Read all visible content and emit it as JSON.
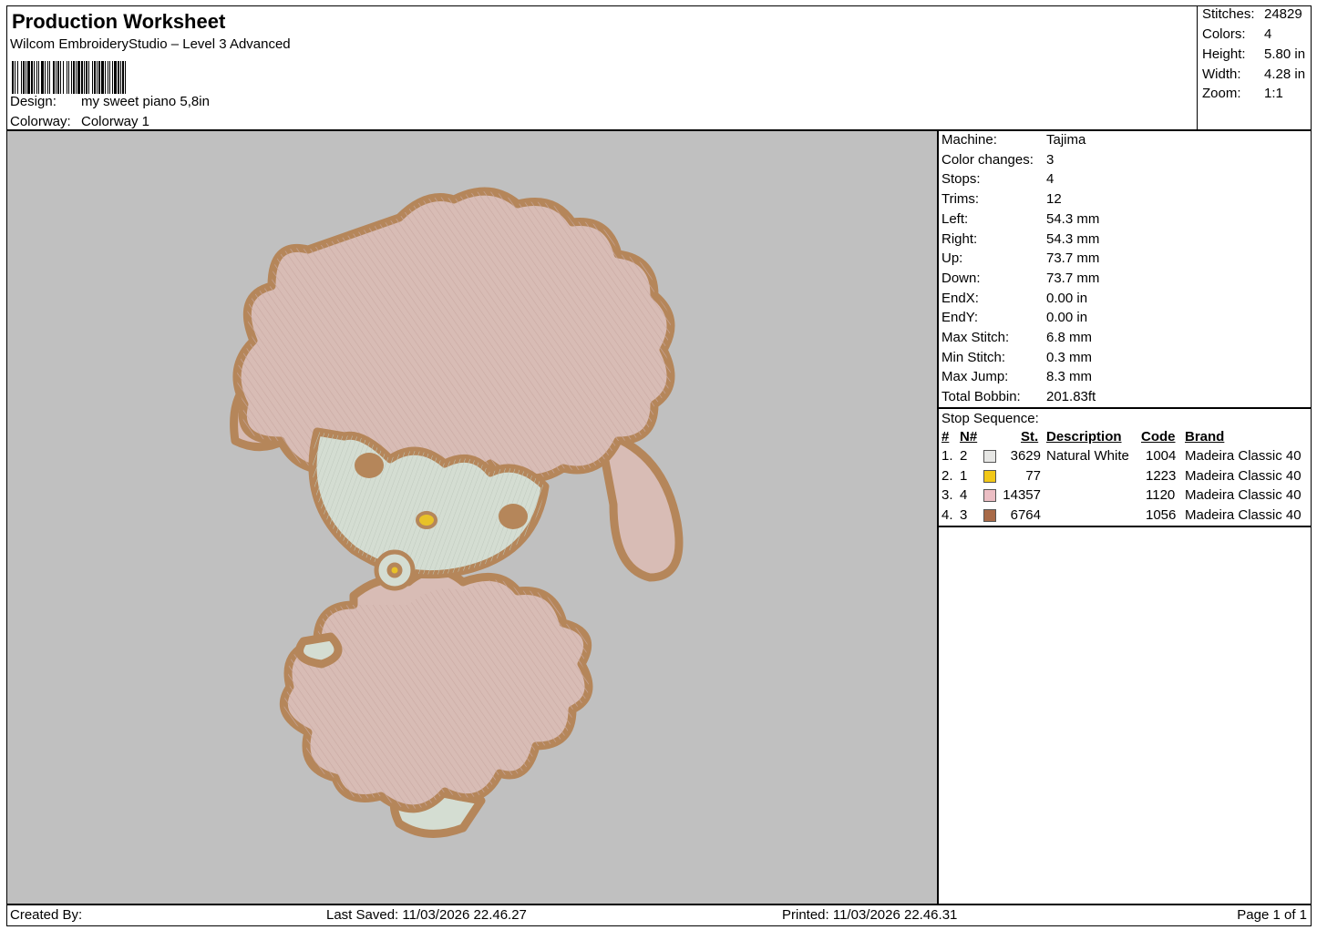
{
  "header": {
    "title": "Production Worksheet",
    "subtitle": "Wilcom EmbroideryStudio – Level 3 Advanced",
    "design_label": "Design:",
    "design_value": "my sweet piano 5,8in",
    "colorway_label": "Colorway:",
    "colorway_value": "Colorway 1"
  },
  "summary": [
    {
      "label": "Stitches:",
      "value": "24829"
    },
    {
      "label": "Colors:",
      "value": "4"
    },
    {
      "label": "Height:",
      "value": "5.80 in"
    },
    {
      "label": "Width:",
      "value": "4.28 in"
    },
    {
      "label": "Zoom:",
      "value": "1:1"
    }
  ],
  "machine_info": [
    {
      "label": "Machine:",
      "value": "Tajima"
    },
    {
      "label": "Color changes:",
      "value": "3"
    },
    {
      "label": "Stops:",
      "value": "4"
    },
    {
      "label": "Trims:",
      "value": "12"
    },
    {
      "label": "Left:",
      "value": "54.3 mm"
    },
    {
      "label": "Right:",
      "value": "54.3 mm"
    },
    {
      "label": "Up:",
      "value": "73.7 mm"
    },
    {
      "label": "Down:",
      "value": "73.7 mm"
    },
    {
      "label": "EndX:",
      "value": "0.00 in"
    },
    {
      "label": "EndY:",
      "value": "0.00 in"
    },
    {
      "label": "Max Stitch:",
      "value": "6.8 mm"
    },
    {
      "label": "Min Stitch:",
      "value": "0.3 mm"
    },
    {
      "label": "Max Jump:",
      "value": "8.3 mm"
    },
    {
      "label": "Total Bobbin:",
      "value": "201.83ft"
    }
  ],
  "stop_sequence": {
    "title": "Stop Sequence:",
    "headers": [
      "#",
      "N#",
      "St.",
      "Description",
      "Code",
      "Brand"
    ],
    "rows": [
      {
        "idx": "1.",
        "n": "2",
        "color": "#e6e6e4",
        "st": "3629",
        "desc": "Natural White",
        "code": "1004",
        "brand": "Madeira Classic 40"
      },
      {
        "idx": "2.",
        "n": "1",
        "color": "#f2c818",
        "st": "77",
        "desc": "",
        "code": "1223",
        "brand": "Madeira Classic 40"
      },
      {
        "idx": "3.",
        "n": "4",
        "color": "#ecbec4",
        "st": "14357",
        "desc": "",
        "code": "1120",
        "brand": "Madeira Classic 40"
      },
      {
        "idx": "4.",
        "n": "3",
        "color": "#a86a48",
        "st": "6764",
        "desc": "",
        "code": "1056",
        "brand": "Madeira Classic 40"
      }
    ]
  },
  "footer": {
    "created_by": "Created By:",
    "last_saved": "Last Saved: 11/03/2026 22.46.27",
    "printed": "Printed: 11/03/2026 22.46.31",
    "page": "Page 1 of 1"
  },
  "colors": {
    "canvas_bg": "#c0c0c0",
    "outline": "#b5865a",
    "body_fill": "#d8bcb5",
    "face_fill": "#d4ddd2",
    "accent": "#e8c228"
  },
  "artwork_label": "embroidery-design-preview"
}
